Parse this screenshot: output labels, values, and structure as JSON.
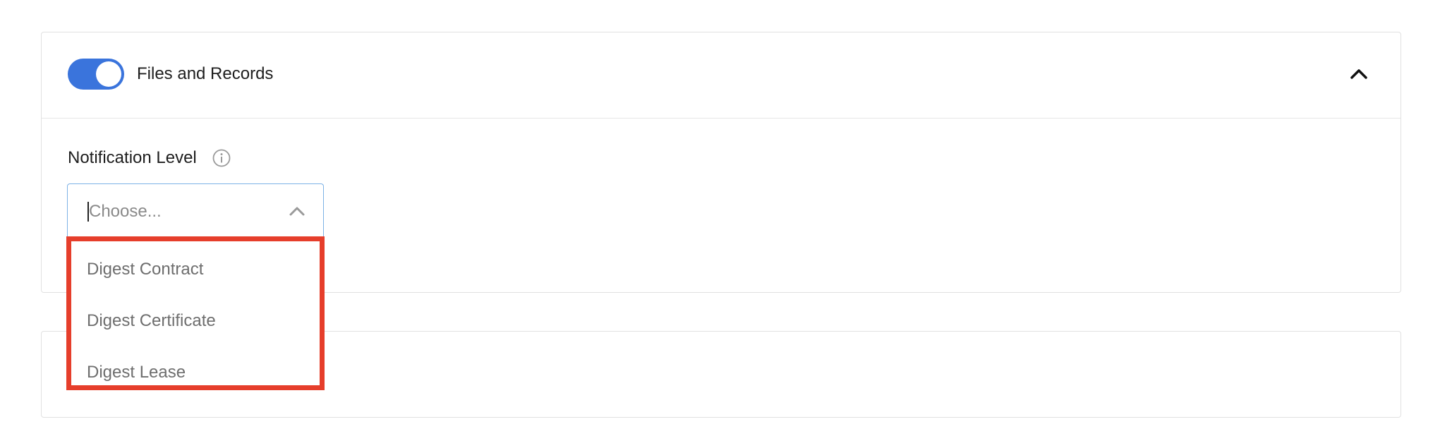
{
  "section": {
    "title": "Files and Records",
    "enabled": true
  },
  "field": {
    "label": "Notification Level",
    "placeholder": "Choose..."
  },
  "dropdown": {
    "options": [
      "Digest Contract",
      "Digest Certificate",
      "Digest Lease"
    ]
  },
  "colors": {
    "toggle_on": "#3a74dc",
    "focus_border": "#7db2e6",
    "highlight_box": "#e63e2b"
  }
}
